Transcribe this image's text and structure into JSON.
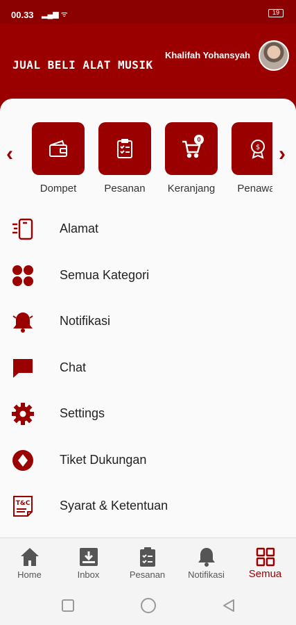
{
  "status_bar": {
    "time": "00.33",
    "signal": "▂▄▆ ᯤ",
    "battery": "19"
  },
  "header": {
    "title": "JUAL BELI ALAT MUSIK",
    "user_name": "Khalifah Yohansyah"
  },
  "quick_menu": [
    {
      "label": "Dompet",
      "icon": "wallet-icon"
    },
    {
      "label": "Pesanan",
      "icon": "clipboard-list-icon"
    },
    {
      "label": "Keranjang",
      "icon": "cart-icon",
      "badge": "0"
    },
    {
      "label": "Penawar",
      "icon": "offer-badge-icon"
    }
  ],
  "menu_list": [
    {
      "label": "Alamat",
      "icon": "address-icon"
    },
    {
      "label": "Semua Kategori",
      "icon": "categories-grid-icon"
    },
    {
      "label": "Notifikasi",
      "icon": "bell-icon"
    },
    {
      "label": "Chat",
      "icon": "chat-icon"
    },
    {
      "label": "Settings",
      "icon": "gear-icon"
    },
    {
      "label": "Tiket Dukungan",
      "icon": "ticket-icon"
    },
    {
      "label": "Syarat & Ketentuan",
      "icon": "terms-icon",
      "icon_text": "T&C"
    }
  ],
  "bottom_nav": [
    {
      "label": "Home",
      "icon": "home-icon"
    },
    {
      "label": "Inbox",
      "icon": "inbox-icon"
    },
    {
      "label": "Pesanan",
      "icon": "clipboard-icon"
    },
    {
      "label": "Notifikasi",
      "icon": "bell-icon"
    },
    {
      "label": "Semua",
      "icon": "grid-icon",
      "active": true
    }
  ],
  "colors": {
    "primary": "#9b0000",
    "background": "#fafafa",
    "nav_inactive": "#555555"
  }
}
